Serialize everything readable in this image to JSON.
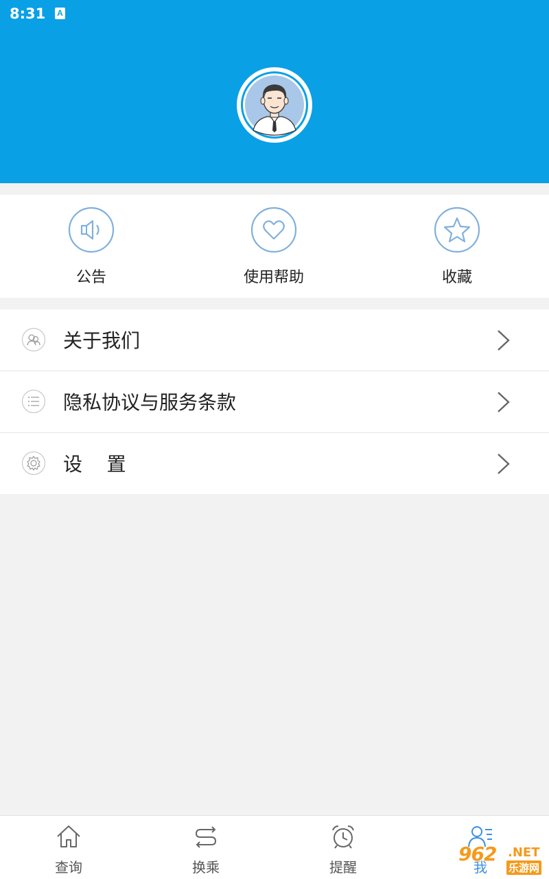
{
  "status_bar": {
    "time": "8:31",
    "indicator": "A"
  },
  "profile": {
    "avatar_icon": "user-avatar-icon"
  },
  "quick_actions": [
    {
      "label": "公告",
      "icon": "speaker-icon"
    },
    {
      "label": "使用帮助",
      "icon": "heart-icon"
    },
    {
      "label": "收藏",
      "icon": "star-icon"
    }
  ],
  "menu": [
    {
      "label": "关于我们",
      "icon": "about-us-icon"
    },
    {
      "label": "隐私协议与服务条款",
      "icon": "list-icon"
    },
    {
      "label": "设    置",
      "icon": "gear-icon"
    }
  ],
  "tabs": [
    {
      "label": "查询",
      "icon": "home-icon",
      "active": false
    },
    {
      "label": "换乘",
      "icon": "transfer-icon",
      "active": false
    },
    {
      "label": "提醒",
      "icon": "alarm-clock-icon",
      "active": false
    },
    {
      "label": "我",
      "icon": "profile-icon",
      "active": true
    }
  ],
  "watermark": {
    "main": "962",
    "net": ".NET",
    "sub": "乐游网"
  },
  "colors": {
    "header": "#0aa0e6",
    "icon_outline": "#7fb0dc",
    "tab_active": "#3d8fe0",
    "watermark": "#f59a1b"
  }
}
